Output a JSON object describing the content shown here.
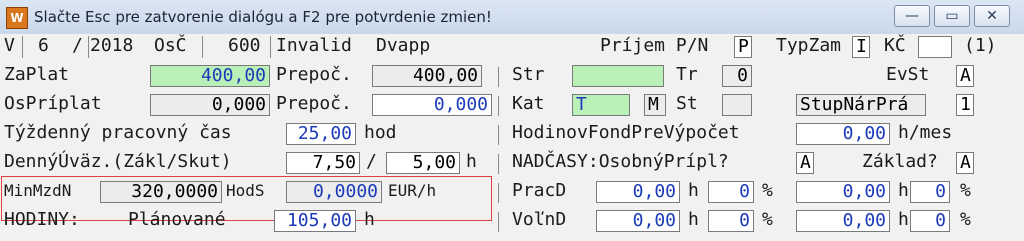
{
  "window": {
    "title": "Slačte Esc pre zatvorenie dialógu a F2 pre potvrdenie zmien!",
    "buttons": [
      "—",
      "▭",
      "✕"
    ]
  },
  "row1": {
    "v": "V",
    "month": "6",
    "slash": "/",
    "year": "2018",
    "osc_label": "OsČ",
    "osc_value": "600",
    "invalid": "Invalid",
    "dvapp": "Dvapp",
    "prijem_label": "Príjem P/N",
    "prijem_value": "P",
    "typzam_label": "TypZam",
    "typzam_value": "I",
    "kc_label": "KČ",
    "kc_value": "",
    "count": "(1)"
  },
  "row2": {
    "zaplat_label": "ZaPlat",
    "zaplat_value": "400,00",
    "prepoc_label": "Prepoč.",
    "prepoc_value": "400,00",
    "str_label": "Str",
    "str_value": "",
    "tr_label": "Tr",
    "tr_value": "0",
    "evst_label": "EvSt",
    "evst_value": "A"
  },
  "row3": {
    "osprip_label": "OsPríplat",
    "osprip_value": "0,000",
    "prepoc_label": "Prepoč.",
    "prepoc_value": "0,000",
    "kat_label": "Kat",
    "kat_value": "T",
    "kat_m": "M",
    "st_label": "St",
    "st_value": "",
    "stupnar_label": "StupNárPrá",
    "stupnar_value": "1"
  },
  "row4": {
    "label": "Týždenný pracovný čas",
    "value": "25,00",
    "unit": "hod",
    "hodfond_label": "HodinovFondPreVýpočet",
    "hodfond_value": "0,00",
    "hodfond_unit": "h/mes"
  },
  "row5": {
    "label": "DennýÚväz.(Zákl/Skut)",
    "zakl": "7,50",
    "slash": "/",
    "skut": "5,00",
    "unit": "h",
    "nadcasy_label": "NADČASY:OsobnýPrípl?",
    "nadcasy_value": "A",
    "zaklad_label": "Základ?",
    "zaklad_value": "A"
  },
  "row6": {
    "minmzdn_label": "MinMzdN",
    "minmzdn_value": "320,0000",
    "hods_label": "HodS",
    "hods_value": "0,0000",
    "hods_unit": "EUR/h",
    "pracd_label": "PracD",
    "pracd_value": "0,00",
    "pracd_h": "h",
    "pracd_pct": "0",
    "pct": "%",
    "pracd_r": "0,00",
    "pracd_h2": "h",
    "pracd_pct2": "0",
    "pct2": "%"
  },
  "row7": {
    "hodiny_label": "HODINY:",
    "planovane_label": "Plánované",
    "planovane_value": "105,00",
    "unit": "h",
    "volnd_label": "VoľnD",
    "volnd_value": "0,00",
    "volnd_h": "h",
    "volnd_pct": "0",
    "pct": "%",
    "volnd_r": "0,00",
    "volnd_h2": "h",
    "volnd_pct2": "0",
    "pct2": "%"
  }
}
